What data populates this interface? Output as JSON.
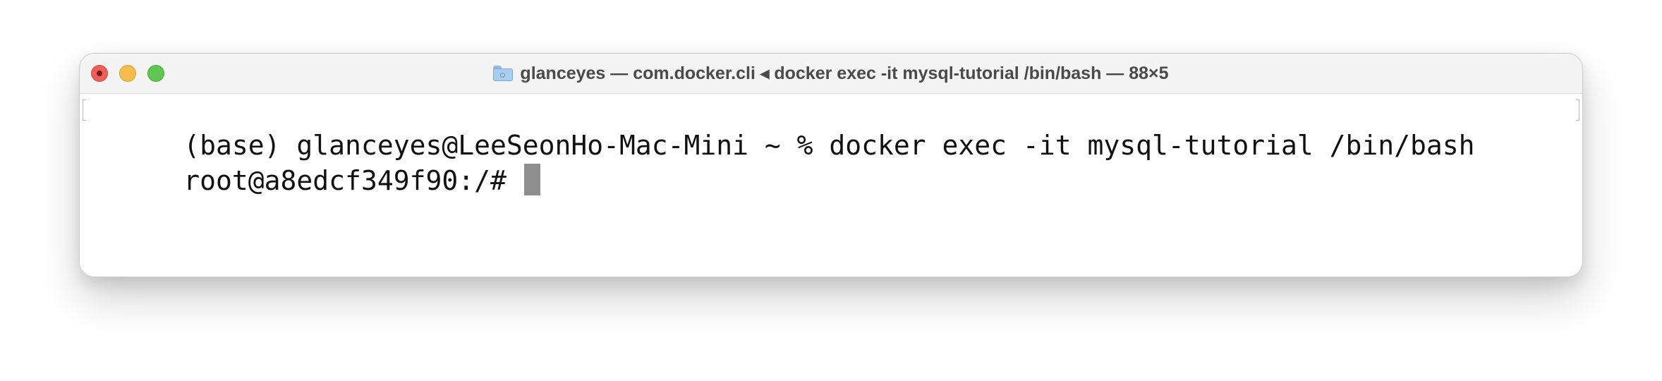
{
  "window": {
    "title": "glanceyes — com.docker.cli ◂ docker exec -it mysql-tutorial /bin/bash — 88×5",
    "folder_icon": "folder-icon"
  },
  "terminal": {
    "lines": [
      "(base) glanceyes@LeeSeonHo-Mac-Mini ~ % docker exec -it mysql-tutorial /bin/bash",
      "root@a8edcf349f90:/# "
    ],
    "cursor_color": "#8e8e8e"
  },
  "colors": {
    "close": "#ee5f57",
    "minimize": "#f5bd4f",
    "zoom": "#60c554"
  }
}
